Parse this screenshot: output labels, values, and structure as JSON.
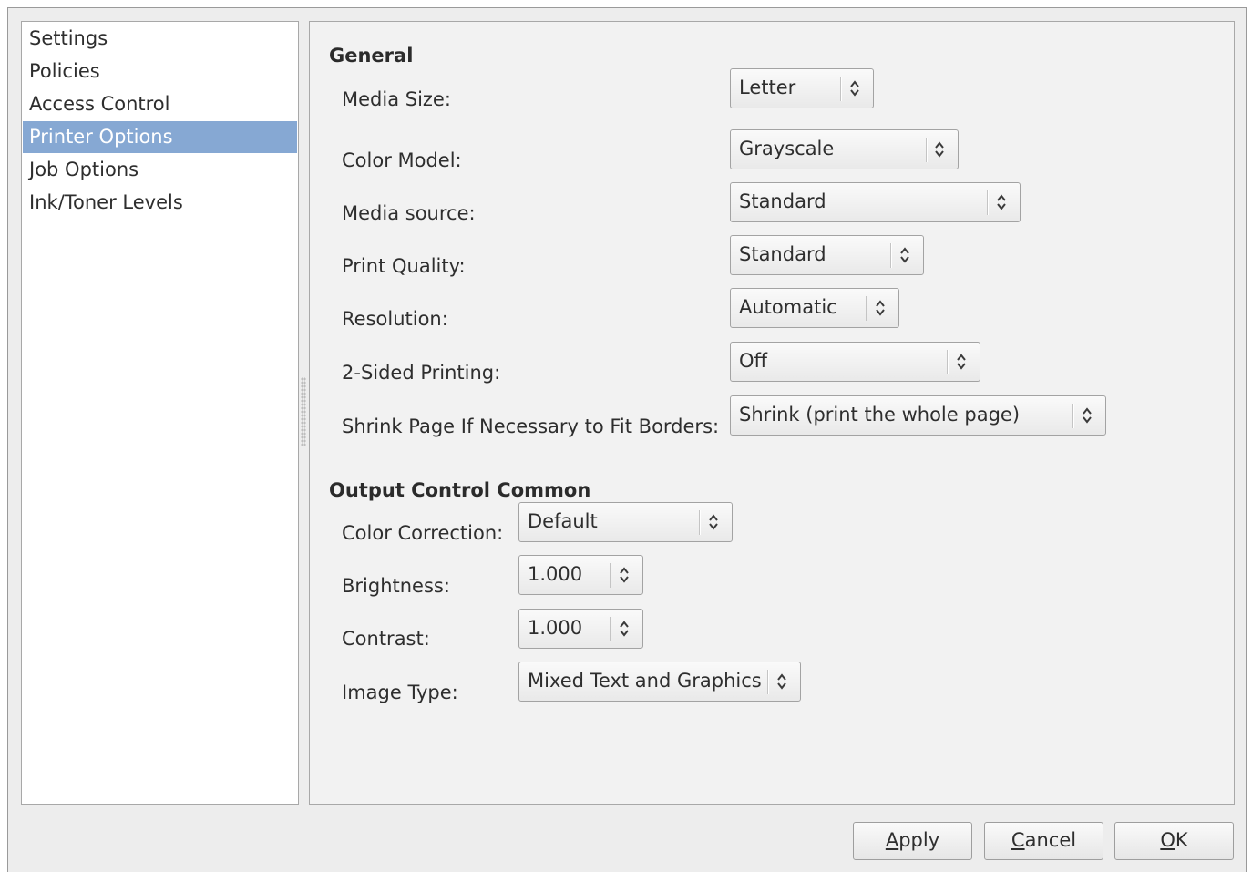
{
  "sidebar": {
    "items": [
      {
        "label": "Settings",
        "selected": false
      },
      {
        "label": "Policies",
        "selected": false
      },
      {
        "label": "Access Control",
        "selected": false
      },
      {
        "label": "Printer Options",
        "selected": true
      },
      {
        "label": "Job Options",
        "selected": false
      },
      {
        "label": "Ink/Toner Levels",
        "selected": false
      }
    ]
  },
  "general": {
    "title": "General",
    "media_size": {
      "label": "Media Size:",
      "value": "Letter"
    },
    "color_model": {
      "label": "Color Model:",
      "value": "Grayscale"
    },
    "media_source": {
      "label": "Media source:",
      "value": "Standard"
    },
    "print_quality": {
      "label": "Print Quality:",
      "value": "Standard"
    },
    "resolution": {
      "label": "Resolution:",
      "value": "Automatic"
    },
    "two_sided": {
      "label": "2-Sided Printing:",
      "value": "Off"
    },
    "shrink_page": {
      "label": "Shrink Page If Necessary to Fit Borders:",
      "value": "Shrink (print the whole page)"
    }
  },
  "output_control": {
    "title": "Output Control Common",
    "color_correction": {
      "label": "Color Correction:",
      "value": "Default"
    },
    "brightness": {
      "label": "Brightness:",
      "value": "1.000"
    },
    "contrast": {
      "label": "Contrast:",
      "value": "1.000"
    },
    "image_type": {
      "label": "Image Type:",
      "value": "Mixed Text and Graphics"
    }
  },
  "buttons": {
    "apply": {
      "mnemonic": "A",
      "rest": "pply"
    },
    "cancel": {
      "mnemonic": "C",
      "rest": "ancel"
    },
    "ok": {
      "mnemonic": "O",
      "rest": "K"
    }
  },
  "colors": {
    "selection": "#86a8d3",
    "dialog_bg": "#ededed",
    "content_bg": "#f2f2f2"
  },
  "icons": {
    "combo_arrow": "up-down-chevron-icon"
  }
}
